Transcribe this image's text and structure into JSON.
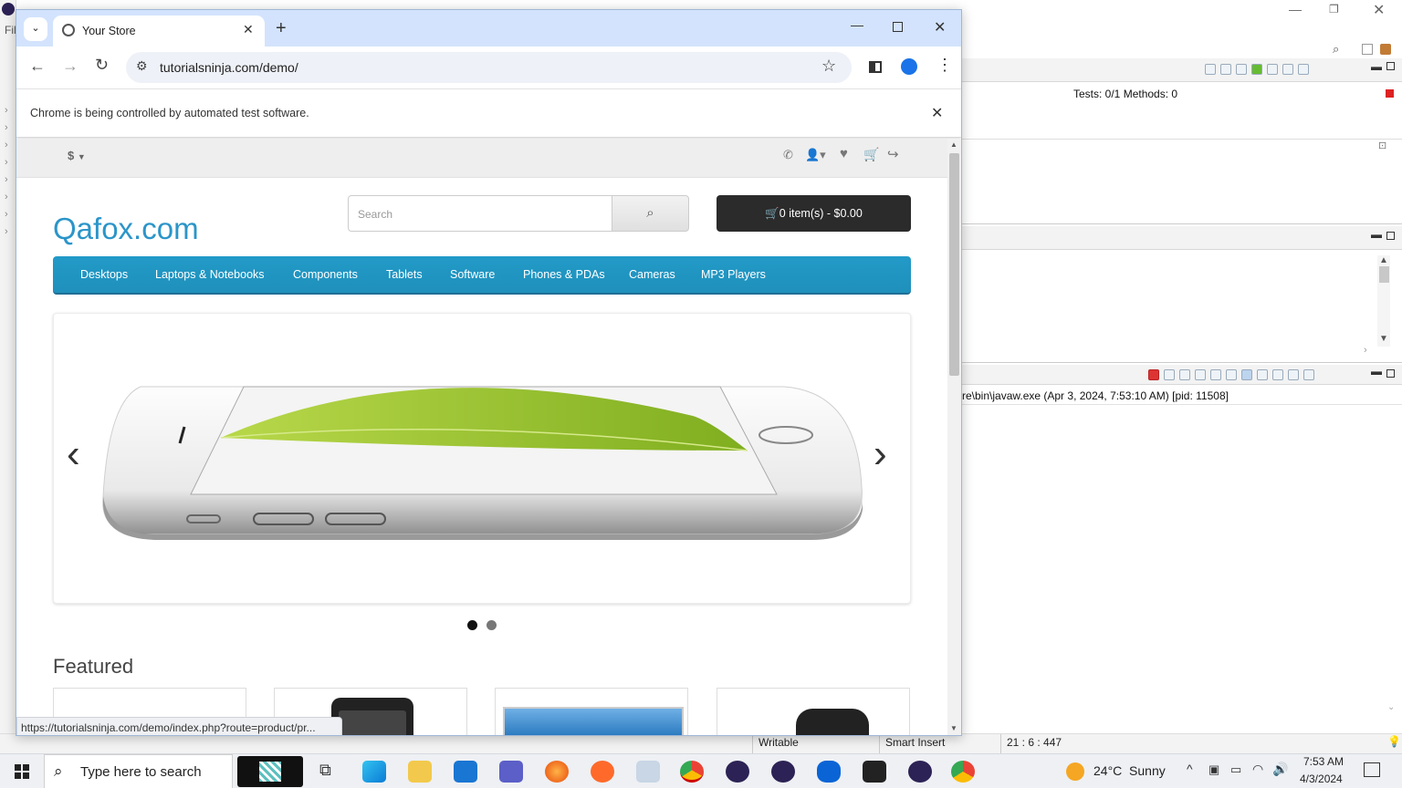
{
  "browser": {
    "tab_title": "Your Store",
    "url": "tutorialsninja.com/demo/",
    "infobar_text": "Chrome is being controlled by automated test software.",
    "status_url": "https://tutorialsninja.com/demo/index.php?route=product/pr..."
  },
  "store": {
    "currency": "$",
    "logo": "Qafox.com",
    "search_placeholder": "Search",
    "cart_label": "0 item(s) - $0.00",
    "menu": [
      "Desktops",
      "Laptops & Notebooks",
      "Components",
      "Tablets",
      "Software",
      "Phones & PDAs",
      "Cameras",
      "MP3 Players"
    ],
    "featured_heading": "Featured",
    "slider_pages": 2,
    "slider_active_page": 1
  },
  "eclipse": {
    "testng_summary": "Tests: 0/1  Methods: 0",
    "console_line": "re\\bin\\javaw.exe  (Apr 3, 2024, 7:53:10 AM) [pid: 11508]",
    "status": {
      "writable": "Writable",
      "insert": "Smart Insert",
      "position": "21 : 6 : 447"
    },
    "menu_fragment": "Fil"
  },
  "taskbar": {
    "search_placeholder": "Type here to search",
    "weather": "24°C  Sunny",
    "time": "7:53 AM",
    "date": "4/3/2024"
  }
}
